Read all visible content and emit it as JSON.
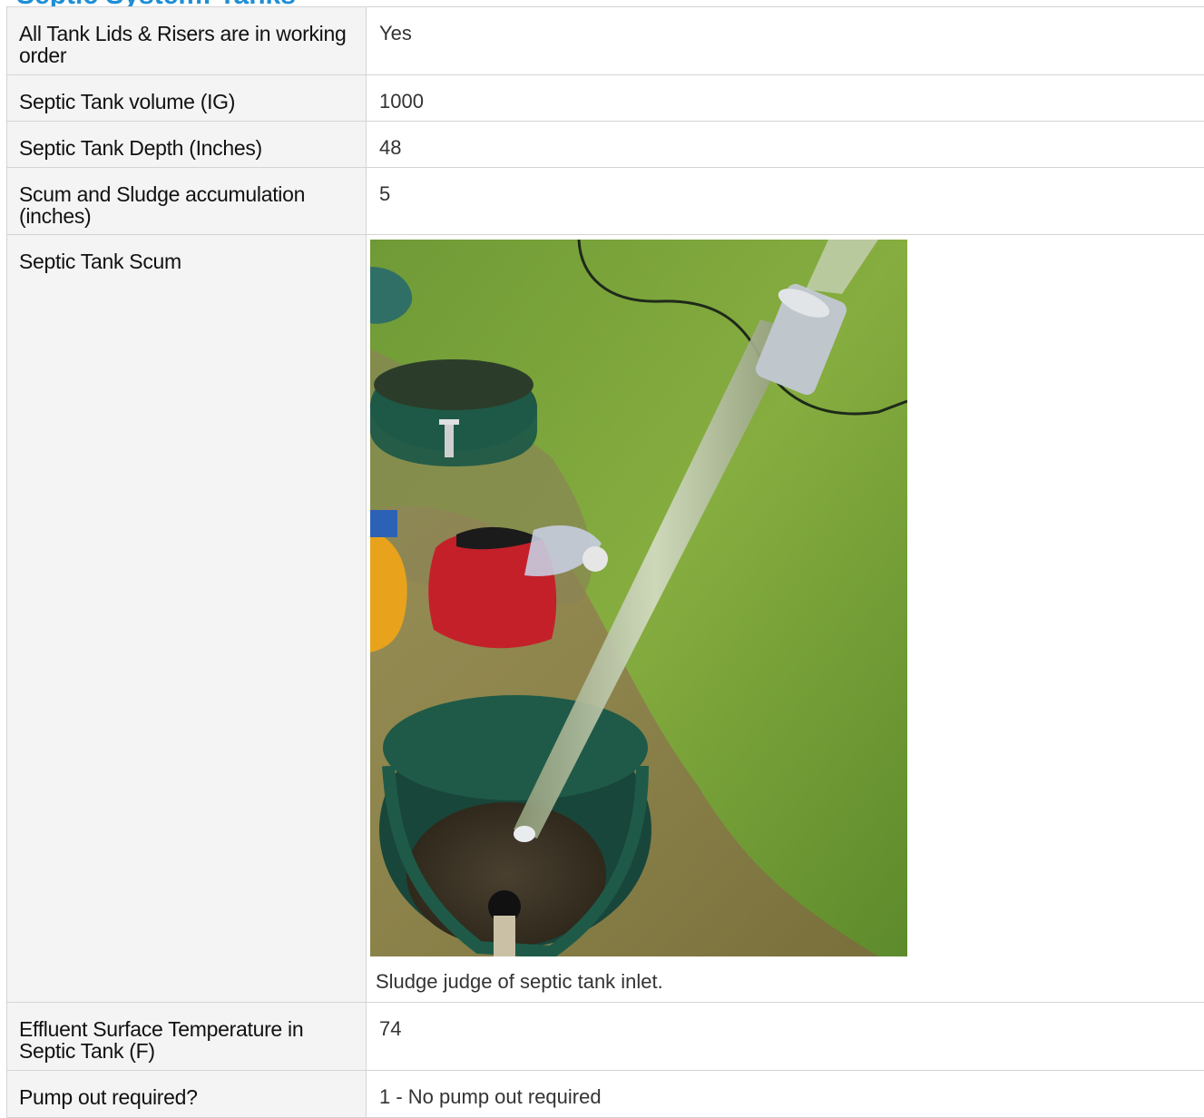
{
  "section": {
    "title": "Septic System: Tanks"
  },
  "rows": [
    {
      "label": "All Tank Lids & Risers are in working order",
      "value": "Yes"
    },
    {
      "label": "Septic Tank volume (IG)",
      "value": "1000"
    },
    {
      "label": "Septic Tank Depth (Inches)",
      "value": "48"
    },
    {
      "label": "Scum and Sludge accumulation (inches)",
      "value": "5"
    },
    {
      "label": "Septic Tank Scum",
      "caption": "Sludge judge of septic tank inlet."
    },
    {
      "label": "Effluent Surface Temperature in Septic Tank (F)",
      "value": "74"
    },
    {
      "label": "Pump out required?",
      "value": "1 - No pump out required"
    }
  ],
  "colors": {
    "title": "#1f8fd6",
    "label_bg": "#f4f4f4",
    "border": "#d4d4d4"
  }
}
